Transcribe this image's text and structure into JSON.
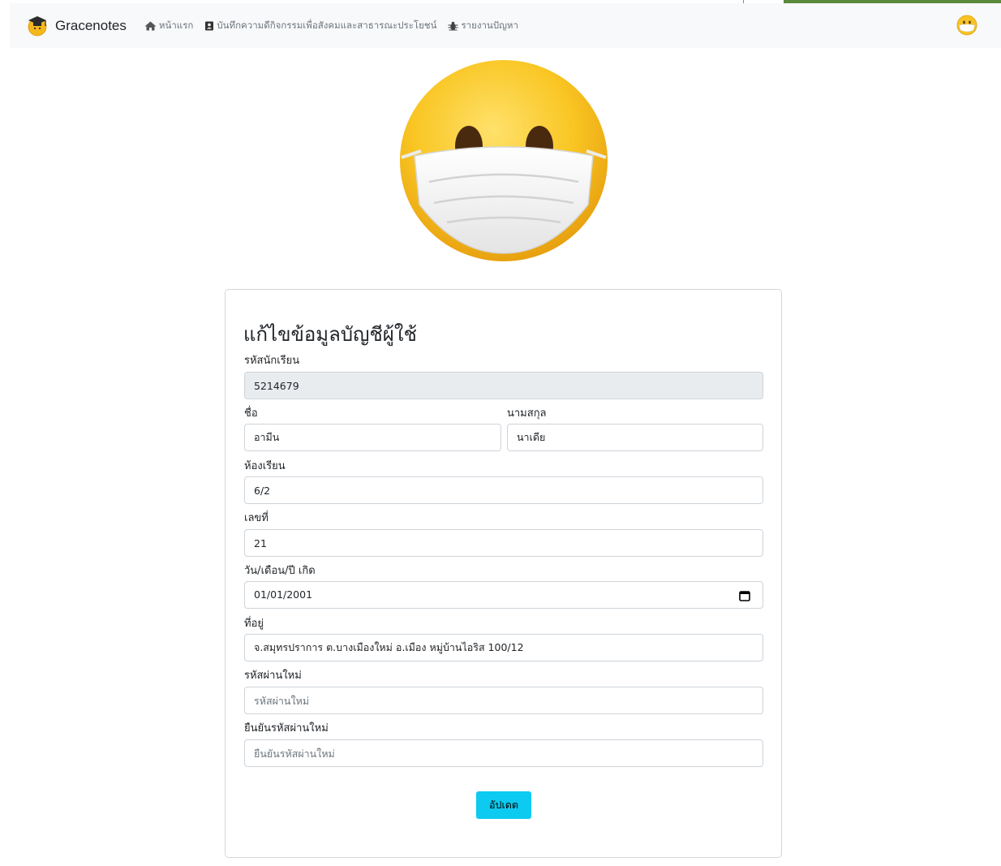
{
  "navbar": {
    "brand": "Gracenotes",
    "links": [
      {
        "label": "หน้าแรก",
        "icon": "home-icon"
      },
      {
        "label": "บันทึกความดีกิจกรรมเพื่อสังคมและสาธารณะประโยชน์",
        "icon": "address-book-icon"
      },
      {
        "label": "รายงานปัญหา",
        "icon": "bug-icon"
      }
    ],
    "avatar_icon": "masked-face-emoji-icon"
  },
  "hero_icon": "masked-face-emoji-icon",
  "form": {
    "title": "แก้ไขข้อมูลบัญชีผู้ใช้",
    "student_id_label": "รหัสนักเรียน",
    "student_id_value": "5214679",
    "first_name_label": "ชื่อ",
    "first_name_value": "อามีน",
    "last_name_label": "นามสกุล",
    "last_name_value": "นาเดีย",
    "classroom_label": "ห้องเรียน",
    "classroom_value": "6/2",
    "number_label": "เลขที่",
    "number_value": "21",
    "birthdate_label": "วัน/เดือน/ปี เกิด",
    "birthdate_value": "01/01/2001",
    "address_label": "ที่อยู่",
    "address_value": "จ.สมุทรปราการ ต.บางเมืองใหม่ อ.เมือง หมู่บ้านไอริส 100/12",
    "new_password_label": "รหัสผ่านใหม่",
    "new_password_placeholder": "รหัสผ่านใหม่",
    "confirm_password_label": "ยืนยันรหัสผ่านใหม่",
    "confirm_password_placeholder": "ยืนยันรหัสผ่านใหม่",
    "submit_label": "อัปเดต"
  },
  "colors": {
    "navbar_bg": "#f8f9fa",
    "button_bg": "#0dcaf0",
    "readonly_bg": "#e9ecef",
    "accent_green": "#5a8a3a",
    "emoji_yellow": "#f5b81a"
  }
}
